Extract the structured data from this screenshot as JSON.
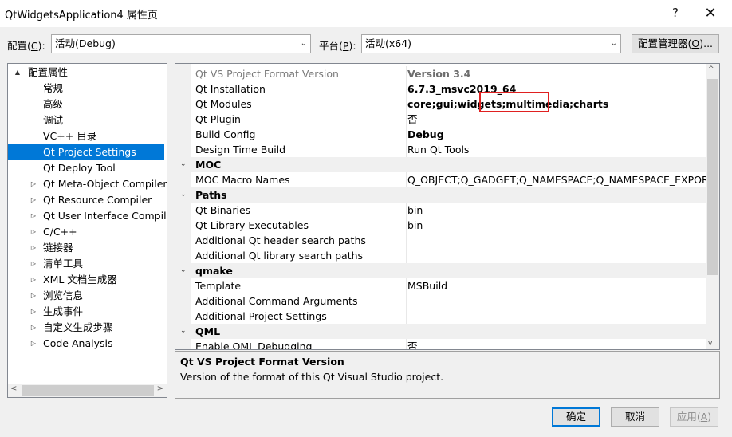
{
  "window": {
    "title": "QtWidgetsApplication4 属性页",
    "help_glyph": "?",
    "close_glyph": "✕"
  },
  "config_bar": {
    "config_label": "配置(",
    "config_key": "C",
    "config_label_end": "):",
    "config_value": "活动(Debug)",
    "platform_label": "平台(",
    "platform_key": "P",
    "platform_label_end": "):",
    "platform_value": "活动(x64)",
    "manager_label_pre": "配置管理器(",
    "manager_key": "O",
    "manager_label_post": ")..."
  },
  "tree": {
    "items": [
      {
        "label": "配置属性",
        "expander": "▲"
      },
      {
        "label": "常规",
        "expander": ""
      },
      {
        "label": "高级",
        "expander": ""
      },
      {
        "label": "调试",
        "expander": ""
      },
      {
        "label": "VC++ 目录",
        "expander": ""
      },
      {
        "label": "Qt Project Settings",
        "expander": "",
        "selected": true
      },
      {
        "label": "Qt Deploy Tool",
        "expander": ""
      },
      {
        "label": "Qt Meta-Object Compiler",
        "expander": "▷"
      },
      {
        "label": "Qt Resource Compiler",
        "expander": "▷"
      },
      {
        "label": "Qt User Interface Compile",
        "expander": "▷"
      },
      {
        "label": "C/C++",
        "expander": "▷"
      },
      {
        "label": "链接器",
        "expander": "▷"
      },
      {
        "label": "清单工具",
        "expander": "▷"
      },
      {
        "label": "XML 文档生成器",
        "expander": "▷"
      },
      {
        "label": "浏览信息",
        "expander": "▷"
      },
      {
        "label": "生成事件",
        "expander": "▷"
      },
      {
        "label": "自定义生成步骤",
        "expander": "▷"
      },
      {
        "label": "Code Analysis",
        "expander": "▷"
      }
    ],
    "scroll_left": "<",
    "scroll_right": ">"
  },
  "grid": {
    "rows": [
      {
        "kind": "prop",
        "name": "Qt VS Project Format Version",
        "value": "Version 3.4",
        "bold": true,
        "dim": true
      },
      {
        "kind": "prop",
        "name": "Qt Installation",
        "value": "6.7.3_msvc2019_64",
        "bold": true
      },
      {
        "kind": "prop",
        "name": "Qt Modules",
        "value": "core;gui;widgets;multimedia;charts",
        "bold": true
      },
      {
        "kind": "prop",
        "name": "Qt Plugin",
        "value": "否"
      },
      {
        "kind": "prop",
        "name": "Build Config",
        "value": "Debug",
        "bold": true
      },
      {
        "kind": "prop",
        "name": "Design Time Build",
        "value": "Run Qt Tools"
      },
      {
        "kind": "cat",
        "name": "MOC",
        "expander": "⌄"
      },
      {
        "kind": "prop",
        "name": "MOC Macro Names",
        "value": "Q_OBJECT;Q_GADGET;Q_NAMESPACE;Q_NAMESPACE_EXPORT"
      },
      {
        "kind": "cat",
        "name": "Paths",
        "expander": "⌄"
      },
      {
        "kind": "prop",
        "name": "Qt Binaries",
        "value": "bin"
      },
      {
        "kind": "prop",
        "name": "Qt Library Executables",
        "value": "bin"
      },
      {
        "kind": "prop",
        "name": "Additional Qt header search paths",
        "value": ""
      },
      {
        "kind": "prop",
        "name": "Additional Qt library search paths",
        "value": ""
      },
      {
        "kind": "cat",
        "name": "qmake",
        "expander": "⌄"
      },
      {
        "kind": "prop",
        "name": "Template",
        "value": "MSBuild"
      },
      {
        "kind": "prop",
        "name": "Additional Command Arguments",
        "value": ""
      },
      {
        "kind": "prop",
        "name": "Additional Project Settings",
        "value": ""
      },
      {
        "kind": "cat",
        "name": "QML",
        "expander": "⌄"
      },
      {
        "kind": "prop",
        "name": "Enable QML Debugging",
        "value": "否"
      }
    ],
    "scroll_up": "^",
    "scroll_down": "v",
    "highlight_color": "#e02020"
  },
  "description": {
    "title": "Qt VS Project Format Version",
    "text": "Version of the format of this Qt Visual Studio project."
  },
  "buttons": {
    "ok": "确定",
    "cancel": "取消",
    "apply_pre": "应用(",
    "apply_key": "A",
    "apply_post": ")"
  },
  "colors": {
    "selection": "#0078d7",
    "window_bg": "#f0f0f0"
  }
}
